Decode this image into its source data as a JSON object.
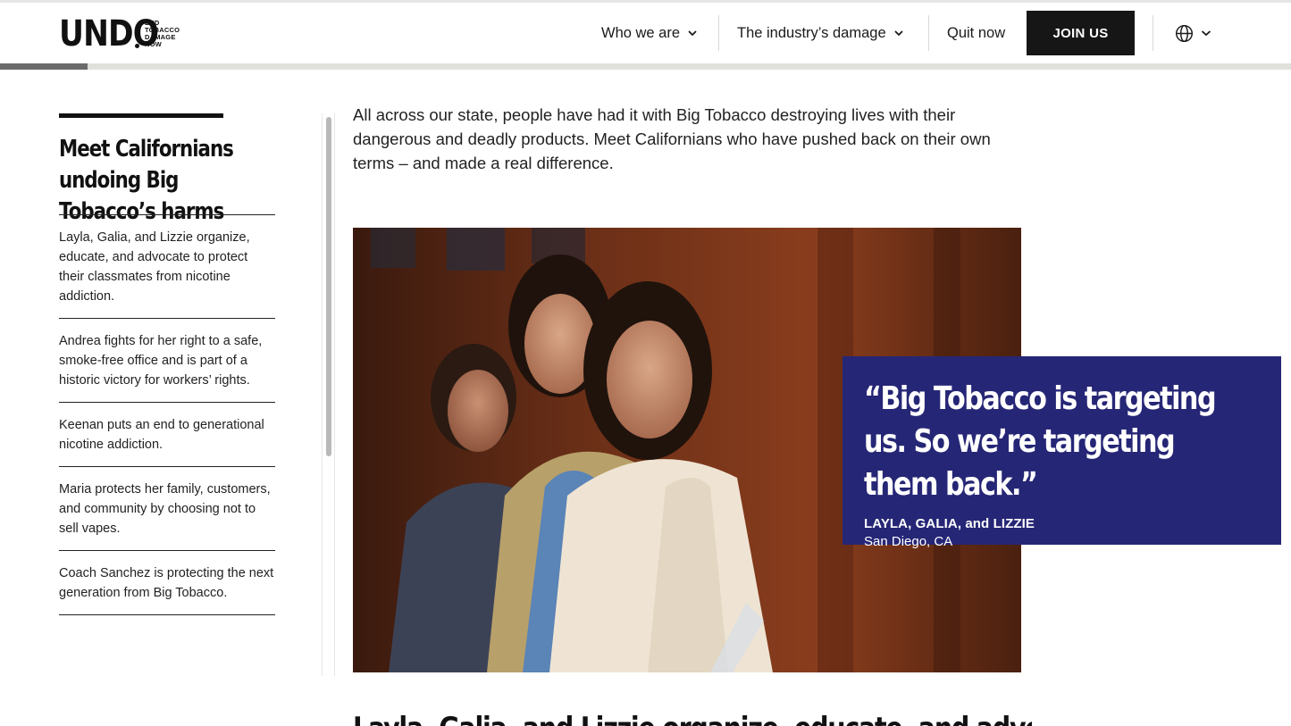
{
  "header": {
    "logo": {
      "word": "UNDO",
      "tagline": [
        "END",
        "TOBACCO",
        "DAMAGE",
        "NOW"
      ]
    },
    "nav": [
      {
        "label": "Who we are",
        "has_dropdown": true
      },
      {
        "label": "The industry’s damage",
        "has_dropdown": true
      },
      {
        "label": "Quit now",
        "has_dropdown": false
      }
    ],
    "join_label": "JOIN US",
    "language_icon": "globe-icon"
  },
  "progress": {
    "fraction": 0.068
  },
  "sidebar": {
    "title": "Meet Californians undoing Big Tobacco’s harms",
    "items": [
      {
        "text": "Layla, Galia, and Lizzie organize, educate, and advocate to protect their classmates from nicotine addiction."
      },
      {
        "text": "Andrea fights for her right to a safe, smoke-free office and is part of a historic victory for workers’ rights."
      },
      {
        "text": "Keenan puts an end to generational nicotine addiction."
      },
      {
        "text": "Maria protects her family, customers, and community by choosing not to sell vapes."
      },
      {
        "text": "Coach Sanchez is protecting the next generation from Big Tobacco."
      }
    ]
  },
  "main": {
    "intro": "All across our state, people have had it with Big Tobacco destroying lives with their dangerous and deadly products. Meet Californians who have pushed back on their own terms – and made a real difference.",
    "quote": {
      "text": "“Big Tobacco is targeting us. So we’re targeting them back.”",
      "name": "LAYLA, GALIA, and LIZZIE",
      "location": "San Diego, CA"
    },
    "next_heading": "Layla, Galia, and Lizzie organize, educate, and advocate"
  },
  "colors": {
    "accent": "#262676",
    "button": "#161616"
  }
}
